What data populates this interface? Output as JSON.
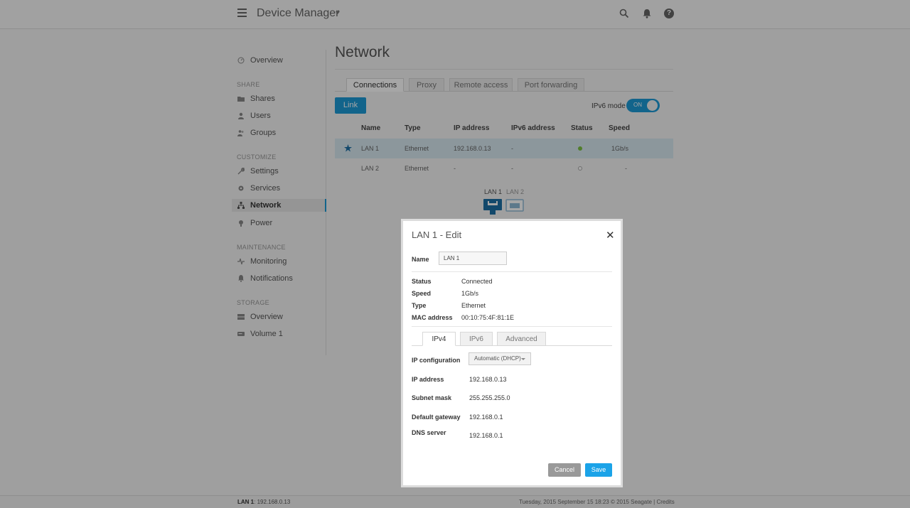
{
  "app": {
    "title": "Device Manager"
  },
  "sidebar": {
    "items": [
      {
        "label": "Overview"
      },
      {
        "label": "Shares"
      },
      {
        "label": "Users"
      },
      {
        "label": "Groups"
      },
      {
        "label": "Settings"
      },
      {
        "label": "Services"
      },
      {
        "label": "Network"
      },
      {
        "label": "Power"
      },
      {
        "label": "Monitoring"
      },
      {
        "label": "Notifications"
      },
      {
        "label": "Overview"
      },
      {
        "label": "Volume 1"
      }
    ],
    "sections": [
      "SHARE",
      "CUSTOMIZE",
      "MAINTENANCE",
      "STORAGE"
    ],
    "active": "Network"
  },
  "page": {
    "title": "Network",
    "tabs": [
      "Connections",
      "Proxy",
      "Remote access",
      "Port forwarding"
    ],
    "link_button": "Link",
    "ipv6_mode": {
      "label": "IPv6 mode",
      "state": "ON"
    }
  },
  "table": {
    "columns": [
      "Name",
      "Type",
      "IP address",
      "IPv6 address",
      "Status",
      "Speed"
    ],
    "rows": [
      {
        "name": "LAN 1",
        "type": "Ethernet",
        "ip": "192.168.0.13",
        "ipv6": "-",
        "status": "connected",
        "speed": "1Gb/s"
      },
      {
        "name": "LAN 2",
        "type": "Ethernet",
        "ip": "-",
        "ipv6": "-",
        "status": "disconnected",
        "speed": "-"
      }
    ]
  },
  "ports": [
    "LAN 1",
    "LAN 2"
  ],
  "modal": {
    "title": "LAN 1 - Edit",
    "name_label": "Name",
    "name_value": "LAN 1",
    "info": [
      {
        "label": "Status",
        "value": "Connected"
      },
      {
        "label": "Speed",
        "value": "1Gb/s"
      },
      {
        "label": "Type",
        "value": "Ethernet"
      },
      {
        "label": "MAC address",
        "value": "00:10:75:4F:81:1E"
      }
    ],
    "tabs": [
      "IPv4",
      "IPv6",
      "Advanced"
    ],
    "ip_config_label": "IP configuration",
    "ip_config_value": "Automatic (DHCP)",
    "fields": [
      {
        "label": "IP address",
        "value": "192.168.0.13"
      },
      {
        "label": "Subnet mask",
        "value": "255.255.255.0"
      },
      {
        "label": "Default gateway",
        "value": "192.168.0.1"
      },
      {
        "label": "DNS server",
        "value": "192.168.0.1"
      }
    ],
    "cancel": "Cancel",
    "save": "Save"
  },
  "footer": {
    "lan_label": "LAN 1",
    "lan_ip": ": 192.168.0.13",
    "right": "Tuesday, 2015 September 15   18:23   © 2015 Seagate | Credits"
  },
  "colors": {
    "accent": "#1d9ad6",
    "status_ok": "#7cc142",
    "overlay": "rgba(0,0,0,0.35)"
  }
}
